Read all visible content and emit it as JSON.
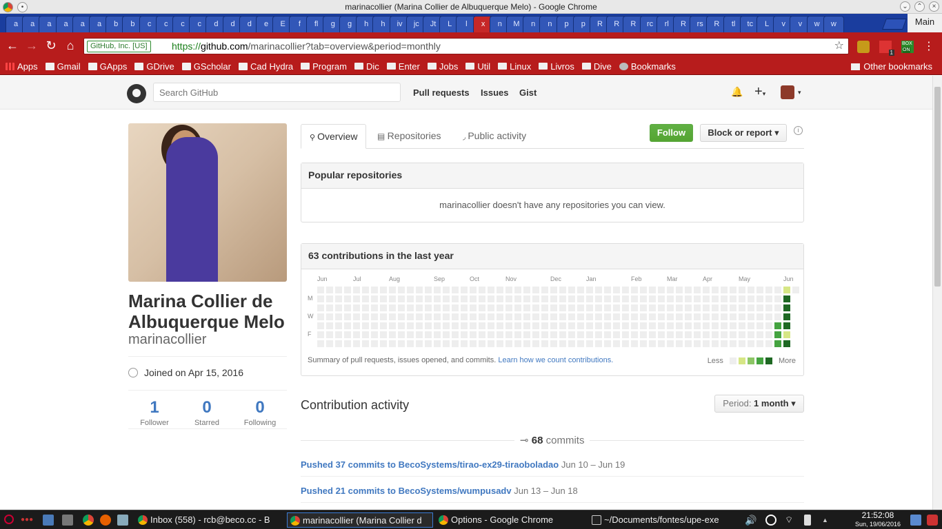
{
  "window": {
    "title": "marinacollier (Marina Collier de Albuquerque Melo) - Google Chrome"
  },
  "tabs": [
    "a",
    "a",
    "a",
    "a",
    "a",
    "a",
    "b",
    "b",
    "c",
    "c",
    "c",
    "c",
    "d",
    "d",
    "d",
    "e",
    "E",
    "f",
    "fl",
    "g",
    "g",
    "h",
    "h",
    "iv",
    "jc",
    "Jt",
    "L",
    "l",
    "x",
    "n",
    "M",
    "n",
    "n",
    "p",
    "p",
    "R",
    "R",
    "R",
    "rc",
    "rl",
    "R",
    "rs",
    "R",
    "tl",
    "tc",
    "L",
    "v",
    "v",
    "w",
    "w"
  ],
  "active_tab_index": 28,
  "main_tab_label": "Main",
  "omnibox": {
    "security": "GitHub, Inc. [US]",
    "scheme": "https://",
    "host": "github.com",
    "path": "/marinacollier?tab=overview&period=monthly"
  },
  "bookmarks": [
    "Apps",
    "Gmail",
    "GApps",
    "GDrive",
    "GScholar",
    "Cad Hydra",
    "Program",
    "Dic",
    "Enter",
    "Jobs",
    "Util",
    "Linux",
    "Livros",
    "Dive",
    "Bookmarks"
  ],
  "other_bookmarks": "Other bookmarks",
  "ext_badges": {
    "one": "1",
    "on": "ON",
    "box": "BOX"
  },
  "gh": {
    "search_placeholder": "Search GitHub",
    "nav": {
      "pulls": "Pull requests",
      "issues": "Issues",
      "gist": "Gist"
    },
    "plus": "+",
    "bell": "🔔"
  },
  "profile": {
    "fullname": "Marina Collier de Albuquerque Melo",
    "username": "marinacollier",
    "joined": "Joined on Apr 15, 2016",
    "stats": [
      {
        "num": "1",
        "label": "Follower"
      },
      {
        "num": "0",
        "label": "Starred"
      },
      {
        "num": "0",
        "label": "Following"
      }
    ]
  },
  "ptabs": {
    "overview": "Overview",
    "repos": "Repositories",
    "activity": "Public activity"
  },
  "buttons": {
    "follow": "Follow",
    "block": "Block or report ▾",
    "info": "i"
  },
  "popular": {
    "title": "Popular repositories",
    "empty": "marinacollier doesn't have any repositories you can view."
  },
  "contrib": {
    "title": "63 contributions in the last year",
    "months": [
      "Jun",
      "Jul",
      "Aug",
      "Sep",
      "Oct",
      "Nov",
      "Dec",
      "Jan",
      "Feb",
      "Mar",
      "Apr",
      "May",
      "Jun"
    ],
    "days": [
      "M",
      "W",
      "F"
    ],
    "summary": "Summary of pull requests, issues opened, and commits.",
    "learn": "Learn how we count contributions.",
    "less": "Less",
    "more": "More",
    "legend_colors": [
      "#eeeeee",
      "#d6e685",
      "#8cc665",
      "#44a340",
      "#1e6823"
    ],
    "recent_levels": {
      "col51": [
        0,
        0,
        0,
        0,
        3,
        3,
        3
      ],
      "col52": [
        1,
        4,
        4,
        4,
        4,
        1,
        4
      ],
      "col53": [
        0
      ]
    }
  },
  "activity": {
    "title": "Contribution activity",
    "period_prefix": "Period: ",
    "period_value": "1 month ▾",
    "commits_num": "68",
    "commits_word": "commits",
    "pushes": [
      {
        "text": "Pushed 37 commits to BecoSystems/tirao-ex29-tiraoboladao",
        "dates": "Jun 10 – Jun 19"
      },
      {
        "text": "Pushed 21 commits to BecoSystems/wumpusadv",
        "dates": "Jun 13 – Jun 18"
      }
    ]
  },
  "taskbar": {
    "items": [
      "Inbox (558) - rcb@beco.cc - B",
      "marinacollier (Marina Collier d",
      "Options - Google Chrome",
      "~/Documents/fontes/upe-exe"
    ],
    "time": "21:52:08",
    "date": "Sun, 19/06/2016"
  }
}
